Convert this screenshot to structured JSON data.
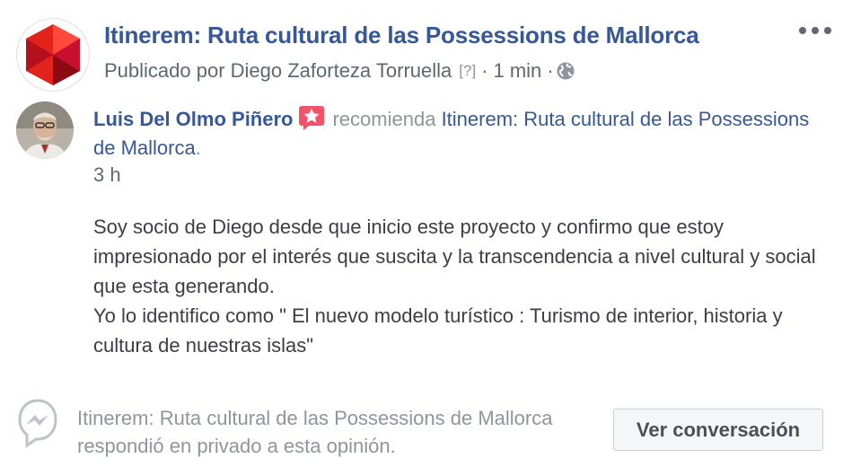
{
  "header": {
    "page_title": "Itinerem: Ruta cultural de las Possessions de Mallorca",
    "published_by": "Publicado por Diego Zaforteza Torruella",
    "help_marker": "[?]",
    "separator": "·",
    "time_ago": "1 min",
    "privacy_icon": "globe-icon",
    "more_icon": "more-options-icon",
    "logo_colors": [
      "#c8102e",
      "#e2231a",
      "#8b0a14",
      "#ff3b3b"
    ]
  },
  "review": {
    "author": "Luis Del Olmo Piñero",
    "badge_icon": "recommend-star-icon",
    "badge_color": "#f35369",
    "verb": "recomienda",
    "page_link": "Itinerem: Ruta cultural de las Possessions de Mallorca",
    "period": ".",
    "timestamp": "3 h",
    "body_lines": [
      "Soy socio de Diego desde que inicio este proyecto y confirmo que estoy impresionado por el interés que suscita y la transcendencia a nivel cultural y social que esta generando.",
      "Yo lo identifico como \" El nuevo modelo turístico : Turismo de interior, historia y cultura de nuestras islas\""
    ]
  },
  "footer": {
    "icon": "messenger-icon",
    "reply_note": "Itinerem: Ruta cultural de las Possessions de Mallorca respondió en privado a esta opinión.",
    "view_button": "Ver conversación"
  },
  "colors": {
    "link": "#365899",
    "muted": "#90949c",
    "text": "#3b3e44"
  }
}
